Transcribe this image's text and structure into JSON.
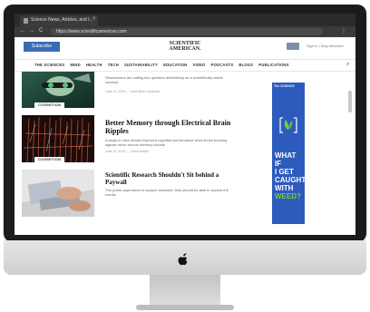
{
  "browser": {
    "tab_title": "Science News, Articles, and I...",
    "tab_close": "×",
    "url": "https://www.scientificamerican.com",
    "back": "←",
    "forward": "→",
    "reload": "C",
    "menu": "⋮"
  },
  "header": {
    "subscribe_label": "Subscribe",
    "logo_line1": "SCIENTIFIC",
    "logo_line2": "AMERICAN.",
    "signin_text": "Sign In  |  Stay Informed"
  },
  "nav": {
    "topics": [
      "THE SCIENCES",
      "MIND",
      "HEALTH",
      "TECH",
      "SUSTAINABILITY",
      "EDUCATION",
      "VIDEO",
      "PODCASTS",
      "BLOGS",
      "PUBLICATIONS"
    ],
    "search_icon": "search-icon"
  },
  "articles": [
    {
      "title": "",
      "desc": "Researchers are calling into question authenticity as a scientifically viable concept",
      "meta": "June 12, 2019 — Scott Barry Kaufman",
      "category": "COGNITION"
    },
    {
      "title": "Better Memory through Electrical Brain Ripples",
      "desc": "A study in mice shows improved cognitive performance when those bursting signals move around memory circuits",
      "meta": "June 12, 2019 — Simon Makin",
      "category": "COGNITION"
    },
    {
      "title": "Scientific Research Shouldn't Sit behind a Paywall",
      "desc": "The public pays taxes to support research; they should be able to access the results",
      "meta": "",
      "category": ""
    }
  ],
  "ad": {
    "tag": "The SCIENCE",
    "line1": "WHAT IF",
    "line2": "I GET",
    "line3": "CAUGHT",
    "line4": "WITH",
    "line5": "WEED?",
    "accent_color": "#2d5bbd",
    "highlight_color": "#6cd13f"
  },
  "colors": {
    "subscribe": "#3b6bb5",
    "bezel": "#1b1b1b"
  }
}
